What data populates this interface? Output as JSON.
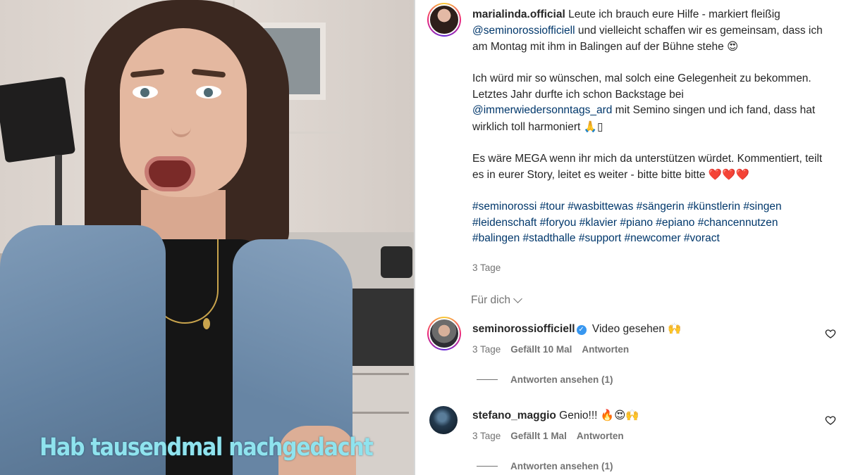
{
  "video": {
    "caption": "Hab tausendmal nachgedacht"
  },
  "post": {
    "author": "marialinda.official",
    "paragraphs": [
      [
        {
          "t": "text",
          "v": "Leute ich brauch eure Hilfe - markiert fleißig "
        },
        {
          "t": "mention",
          "v": "@seminorossiofficiell"
        },
        {
          "t": "text",
          "v": " und vielleicht schaffen wir es gemeinsam, dass ich am Montag mit ihm in Balingen auf der Bühne stehe "
        },
        {
          "t": "emoji",
          "v": "😍"
        }
      ],
      [
        {
          "t": "text",
          "v": "Ich würd mir so wünschen, mal solch eine Gelegenheit zu bekommen. Letztes Jahr durfte ich schon Backstage bei "
        },
        {
          "t": "mention",
          "v": "@immerwiedersonntags_ard"
        },
        {
          "t": "text",
          "v": " mit Semino singen und ich fand, dass hat wirklich toll harmoniert "
        },
        {
          "t": "emoji",
          "v": "🙏"
        },
        {
          "t": "text",
          "v": "▯"
        }
      ],
      [
        {
          "t": "text",
          "v": "Es wäre MEGA wenn ihr mich da unterstützen würdet. Kommentiert, teilt es in eurer Story, leitet es weiter - bitte bitte bitte "
        },
        {
          "t": "heart",
          "v": "❤️❤️❤️"
        }
      ]
    ],
    "hashtags": [
      "#seminorossi",
      "#tour",
      "#wasbittewas",
      "#sängerin",
      "#künstlerin",
      "#singen",
      "#leidenschaft",
      "#foryou",
      "#klavier",
      "#piano",
      "#epiano",
      "#chancennutzen",
      "#balingen",
      "#stadthalle",
      "#support",
      "#newcomer",
      "#voract"
    ],
    "time": "3 Tage",
    "sort_label": "Für dich"
  },
  "comments": [
    {
      "user": "seminorossiofficiell",
      "verified": true,
      "text": "Video gesehen",
      "emoji": "🙌",
      "time": "3 Tage",
      "likes": "Gefällt 10 Mal",
      "reply": "Antworten",
      "view_replies": "Antworten ansehen (1)"
    },
    {
      "user": "stefano_maggio",
      "verified": false,
      "text": "Genio!!!",
      "emoji": "🔥😍🙌",
      "time": "3 Tage",
      "likes": "Gefällt 1 Mal",
      "reply": "Antworten",
      "view_replies": "Antworten ansehen (1)"
    }
  ],
  "colors": {
    "link": "#00376b",
    "muted": "#737373",
    "caption_text": "#8fe3ee",
    "verified": "#3897f0"
  }
}
